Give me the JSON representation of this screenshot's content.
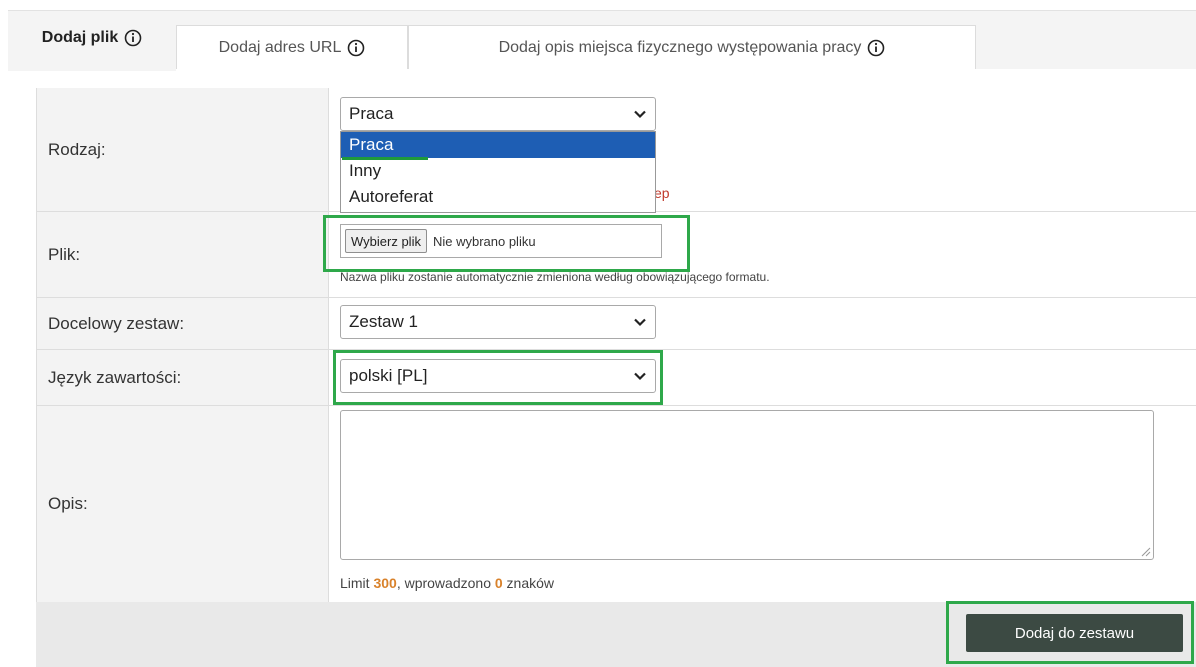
{
  "tabs": [
    {
      "label": "Dodaj plik",
      "active": true
    },
    {
      "label": "Dodaj adres URL",
      "active": false
    },
    {
      "label": "Dodaj opis miejsca fizycznego występowania pracy",
      "active": false
    }
  ],
  "form": {
    "rodzaj": {
      "label": "Rodzaj:",
      "value": "Praca",
      "options": [
        "Praca",
        "Inny",
        "Autoreferat"
      ],
      "partial_text": "ep"
    },
    "plik": {
      "label": "Plik:",
      "button_label": "Wybierz plik",
      "status": "Nie wybrano pliku",
      "hint": "Nazwa pliku zostanie automatycznie zmieniona według obowiązującego formatu."
    },
    "zestaw": {
      "label": "Docelowy zestaw:",
      "value": "Zestaw 1"
    },
    "jezyk": {
      "label": "Język zawartości:",
      "value": "polski [PL]"
    },
    "opis": {
      "label": "Opis:",
      "value": "",
      "limit_prefix": "Limit ",
      "limit": "300",
      "limit_mid": ", wprowadzono ",
      "entered": "0",
      "limit_suffix": " znaków"
    }
  },
  "submit_label": "Dodaj do zestawu",
  "colors": {
    "highlight": "#2ea84a",
    "selected_option": "#1e5eb4",
    "button": "#3c4a43",
    "limit_number": "#d9822b"
  },
  "icons": {
    "tab_info": "info-circle-icon",
    "select_arrow": "chevron-down-icon"
  }
}
